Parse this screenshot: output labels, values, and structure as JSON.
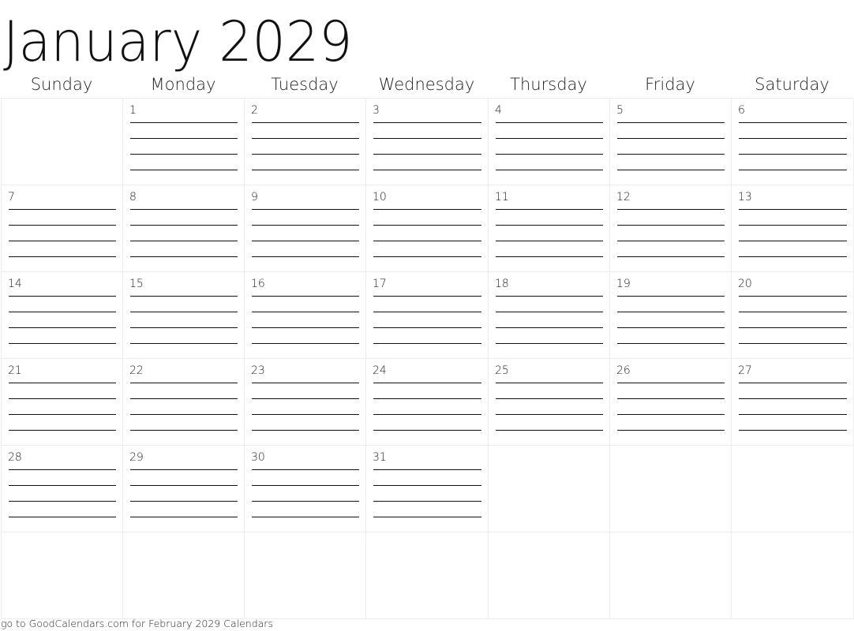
{
  "calendar": {
    "title": "January 2029",
    "weekdays": [
      "Sunday",
      "Monday",
      "Tuesday",
      "Wednesday",
      "Thursday",
      "Friday",
      "Saturday"
    ],
    "weeks": [
      [
        "",
        "1",
        "2",
        "3",
        "4",
        "5",
        "6"
      ],
      [
        "7",
        "8",
        "9",
        "10",
        "11",
        "12",
        "13"
      ],
      [
        "14",
        "15",
        "16",
        "17",
        "18",
        "19",
        "20"
      ],
      [
        "21",
        "22",
        "23",
        "24",
        "25",
        "26",
        "27"
      ],
      [
        "28",
        "29",
        "30",
        "31",
        "",
        "",
        ""
      ],
      [
        "",
        "",
        "",
        "",
        "",
        "",
        ""
      ]
    ],
    "writing_lines_per_day": 4
  },
  "footer": {
    "text": "go to GoodCalendars.com for February 2029 Calendars"
  }
}
